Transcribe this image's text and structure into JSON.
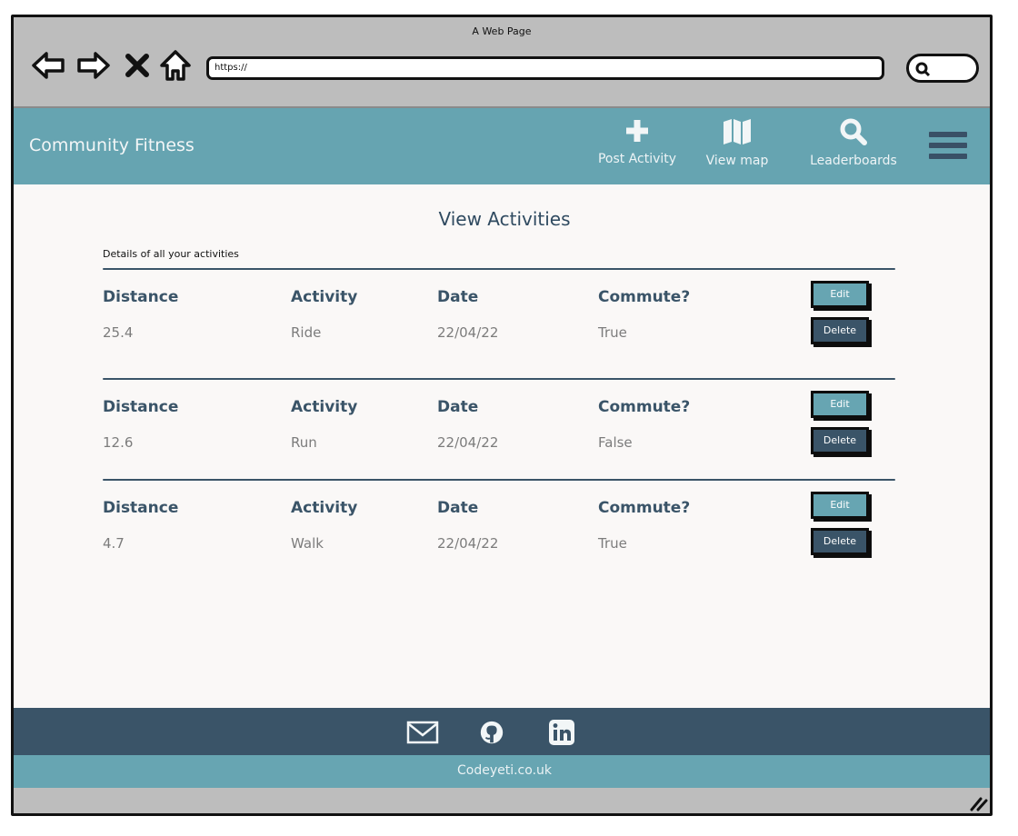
{
  "browser": {
    "window_title": "A Web Page",
    "url": "https://"
  },
  "header": {
    "brand": "Community Fitness",
    "nav": [
      {
        "label": "Post Activity",
        "icon": "plus-icon"
      },
      {
        "label": "View map",
        "icon": "map-icon"
      },
      {
        "label": "Leaderboards",
        "icon": "search-icon"
      }
    ],
    "menu_icon": "hamburger-icon"
  },
  "main": {
    "title": "View Activities",
    "subtitle": "Details of all your activities",
    "columns": [
      "Distance",
      "Activity",
      "Date",
      "Commute?"
    ],
    "activities": [
      {
        "distance": "25.4",
        "activity": "Ride",
        "date": "22/04/22",
        "commute": "True"
      },
      {
        "distance": "12.6",
        "activity": "Run",
        "date": "22/04/22",
        "commute": "False"
      },
      {
        "distance": "4.7",
        "activity": "Walk",
        "date": "22/04/22",
        "commute": "True"
      }
    ],
    "edit_label": "Edit",
    "delete_label": "Delete"
  },
  "footer": {
    "icons": [
      "email-icon",
      "github-icon",
      "linkedin-icon"
    ],
    "site": "Codeyeti.co.uk"
  },
  "colors": {
    "header_bg": "#66a4b1",
    "dark_slate": "#3a5468",
    "content_bg": "#faf8f7",
    "chrome_gray": "#bdbdbd"
  }
}
